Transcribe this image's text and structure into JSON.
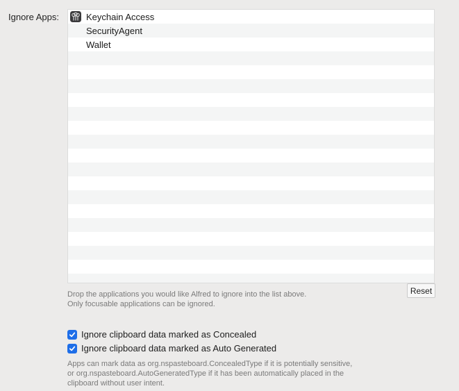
{
  "ignore_apps": {
    "label": "Ignore Apps:",
    "apps": [
      {
        "name": "Keychain Access",
        "icon": "keychain-icon"
      },
      {
        "name": "SecurityAgent",
        "icon": ""
      },
      {
        "name": "Wallet",
        "icon": ""
      }
    ],
    "hint_line1": "Drop the applications you would like Alfred to ignore into the list above.",
    "hint_line2": "Only focusable applications can be ignored.",
    "reset_label": "Reset"
  },
  "options": {
    "concealed": {
      "label": "Ignore clipboard data marked as Concealed",
      "checked": true
    },
    "auto_generated": {
      "label": "Ignore clipboard data marked as Auto Generated",
      "checked": true
    },
    "note_line1": "Apps can mark data as org.nspasteboard.ConcealedType if it is potentially sensitive,",
    "note_line2": "or org.nspasteboard.AutoGeneratedType if it has been automatically placed in the",
    "note_line3": "clipboard without user intent."
  },
  "colors": {
    "background": "#ecebea",
    "checkbox_accent": "#1e6ee8",
    "row_stripe": "#f4f5f5"
  }
}
